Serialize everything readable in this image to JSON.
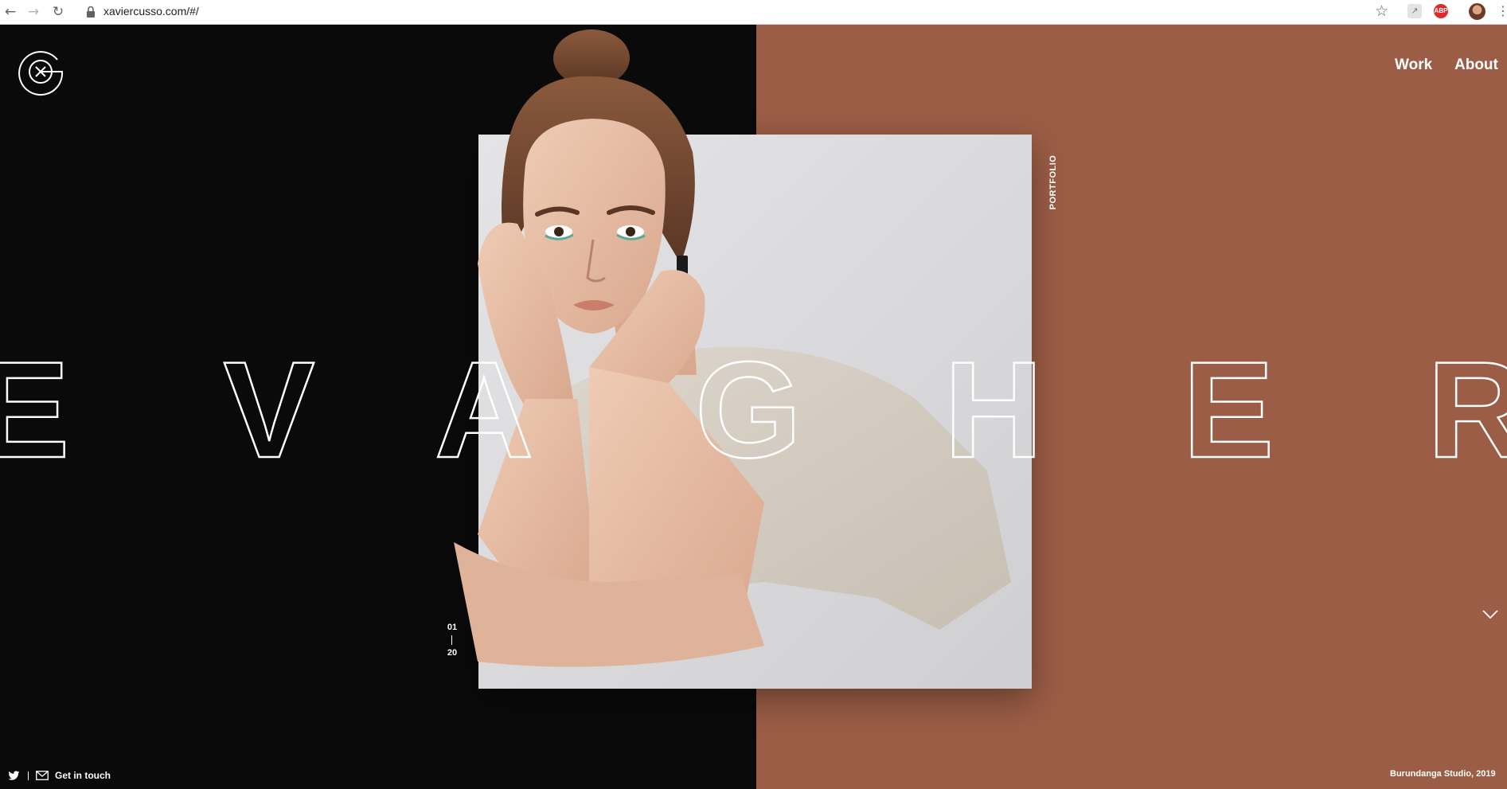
{
  "browser": {
    "url": "xaviercusso.com/#/"
  },
  "nav": {
    "work": "Work",
    "about": "About"
  },
  "hero": {
    "title": "EVA GHER",
    "letters": [
      "E",
      "V",
      "A",
      "G",
      "H",
      "E",
      "R"
    ],
    "side_label": "PORTFOLIO"
  },
  "counter": {
    "current": "01",
    "total": "20"
  },
  "footer": {
    "get_in_touch": "Get in touch",
    "credit": "Burundanga Studio, 2019"
  },
  "colors": {
    "left_background": "#0a0a0a",
    "right_background": "#9b5d45",
    "text": "#ffffff"
  },
  "icons": {
    "logo": "circle-x-g-logo",
    "twitter": "twitter-icon",
    "mail": "mail-icon",
    "scroll": "chevron-down-icon"
  }
}
